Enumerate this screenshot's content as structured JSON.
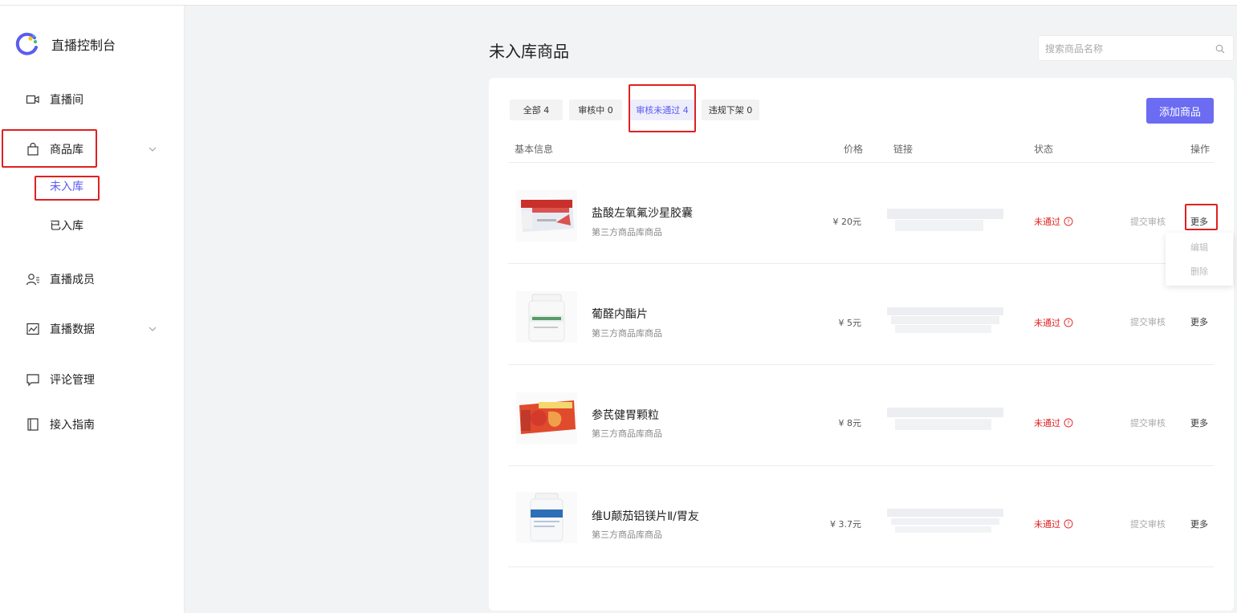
{
  "sidebar": {
    "brand_title": "直播控制台",
    "brand_colors": {
      "ring": "#5b5cf0",
      "dot_yellow": "#f5c518",
      "dot_green": "#3cc47c"
    },
    "items": [
      {
        "label": "直播间",
        "icon": "video-camera-icon"
      },
      {
        "label": "商品库",
        "icon": "shopping-bag-icon",
        "expanded": true
      },
      {
        "label": "直播成员",
        "icon": "members-icon"
      },
      {
        "label": "直播数据",
        "icon": "data-chart-icon"
      },
      {
        "label": "评论管理",
        "icon": "comment-icon"
      },
      {
        "label": "接入指南",
        "icon": "book-icon"
      }
    ],
    "sub_items": [
      {
        "label": "未入库",
        "active": true
      },
      {
        "label": "已入库",
        "active": false
      }
    ]
  },
  "main": {
    "title": "未入库商品",
    "search_placeholder": "搜索商品名称",
    "tabs": [
      {
        "label": "全部 4",
        "active": false
      },
      {
        "label": "审核中 0",
        "active": false
      },
      {
        "label": "审核未通过 4",
        "active": true
      },
      {
        "label": "违规下架 0",
        "active": false
      }
    ],
    "add_button": "添加商品",
    "columns": [
      "基本信息",
      "价格",
      "链接",
      "状态",
      "操作"
    ],
    "rows": [
      {
        "name": "盐酸左氧氟沙星胶囊",
        "source": "第三方商品库商品",
        "price": "¥ 20元",
        "status": "未通过",
        "submit": "提交审核",
        "more": "更多"
      },
      {
        "name": "葡醛内酯片",
        "source": "第三方商品库商品",
        "price": "¥ 5元",
        "status": "未通过",
        "submit": "提交审核",
        "more": "更多"
      },
      {
        "name": "参芪健胃颗粒",
        "source": "第三方商品库商品",
        "price": "¥ 8元",
        "status": "未通过",
        "submit": "提交审核",
        "more": "更多"
      },
      {
        "name": "维U颠茄铝镁片Ⅱ/胃友",
        "source": "第三方商品库商品",
        "price": "¥ 3.7元",
        "status": "未通过",
        "submit": "提交审核",
        "more": "更多"
      }
    ],
    "more_menu": [
      "编辑",
      "删除"
    ],
    "colors": {
      "accent": "#5b5cf0",
      "button": "#6b6cf2",
      "danger": "#e02020",
      "highlight_box": "#e02020"
    }
  }
}
